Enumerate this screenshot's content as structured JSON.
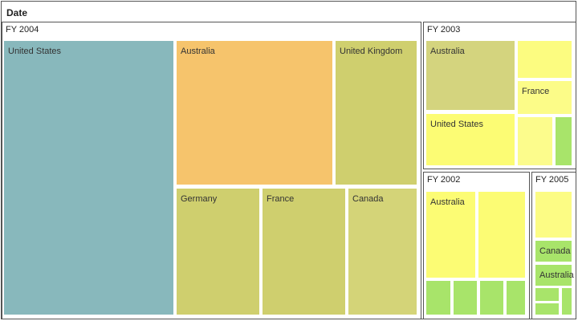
{
  "chart_data": {
    "type": "treemap",
    "title": "Date",
    "groups": [
      {
        "name": "FY 2004",
        "items": [
          {
            "label": "United States",
            "value": 147,
            "color": "#88b8bc"
          },
          {
            "label": "Australia",
            "value": 107,
            "color": "#f6c46c"
          },
          {
            "label": "United Kingdom",
            "value": 52,
            "color": "#cfcf6e"
          },
          {
            "label": "Germany",
            "value": 47,
            "color": "#cfcf6e"
          },
          {
            "label": "France",
            "value": 46,
            "color": "#cfcf6e"
          },
          {
            "label": "Canada",
            "value": 37,
            "color": "#d4d478"
          }
        ]
      },
      {
        "name": "FY 2003",
        "items": [
          {
            "label": "Australia",
            "value": 28,
            "color": "#d4d47e"
          },
          {
            "label": "United States",
            "value": 21,
            "color": "#fcfc74"
          },
          {
            "label": "",
            "value": 9,
            "color": "#fcfc80"
          },
          {
            "label": "France",
            "value": 7,
            "color": "#fcfc88"
          },
          {
            "label": "",
            "value": 6,
            "color": "#fcfc8c"
          },
          {
            "label": "",
            "value": 3,
            "color": "#a8e46a"
          }
        ]
      },
      {
        "name": "FY 2002",
        "items": [
          {
            "label": "Australia",
            "value": 18,
            "color": "#fcfc74"
          },
          {
            "label": "",
            "value": 17,
            "color": "#fcfc74"
          },
          {
            "label": "",
            "value": 4,
            "color": "#a8e46a"
          },
          {
            "label": "",
            "value": 4,
            "color": "#a8e46a"
          },
          {
            "label": "",
            "value": 4,
            "color": "#a8e46a"
          },
          {
            "label": "",
            "value": 4,
            "color": "#a8e46a"
          }
        ]
      },
      {
        "name": "FY 2005",
        "items": [
          {
            "label": "",
            "value": 5,
            "color": "#fcfc84"
          },
          {
            "label": "Canada",
            "value": 2,
            "color": "#a8e46a"
          },
          {
            "label": "Australia",
            "value": 2,
            "color": "#a8e46a"
          },
          {
            "label": "",
            "value": 1,
            "color": "#a8e46a"
          },
          {
            "label": "",
            "value": 1,
            "color": "#a8e46a"
          },
          {
            "label": "",
            "value": 1,
            "color": "#a8e46a"
          }
        ]
      }
    ]
  }
}
